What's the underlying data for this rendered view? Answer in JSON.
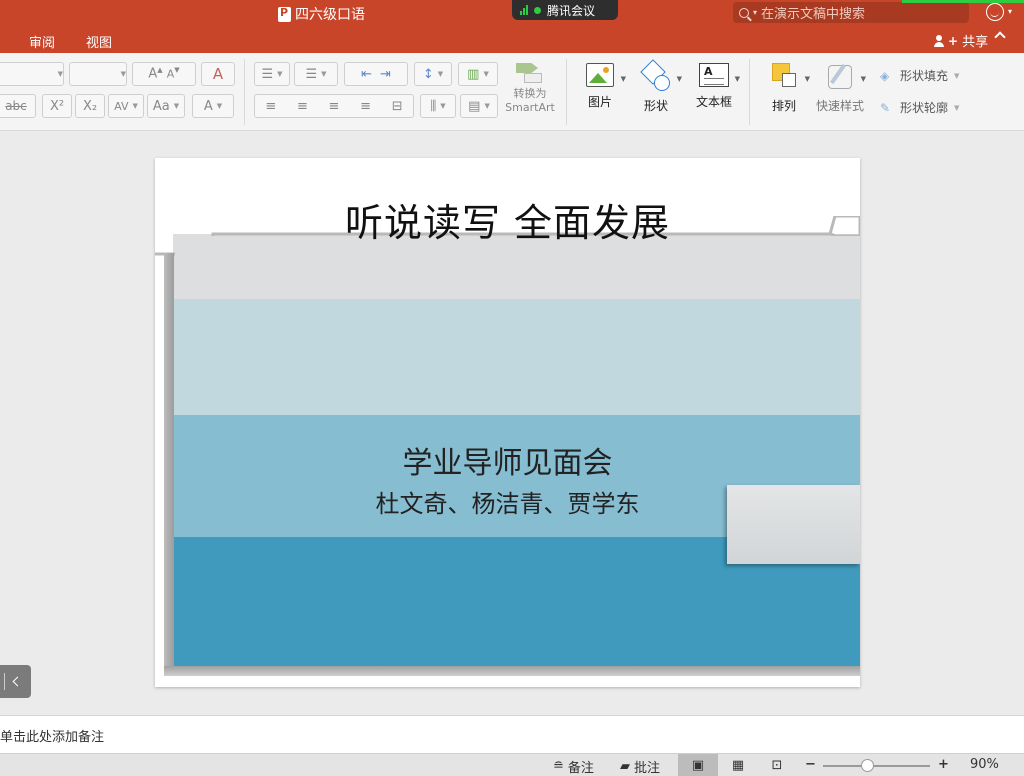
{
  "window": {
    "doc_title": "四六级口语",
    "meeting_label": "腾讯会议",
    "search_placeholder": "在演示文稿中搜索"
  },
  "ribbon": {
    "tabs": [
      {
        "label": "审阅"
      },
      {
        "label": "视图"
      }
    ],
    "share_label": "共享"
  },
  "toolbar": {
    "font_size_glyphs": {
      "grow": "A",
      "shrink": "A"
    },
    "strikethrough": "abc",
    "superscript": "X²",
    "subscript": "X₂",
    "char_spacing": "AV",
    "change_case": "Aa",
    "font_color": "A",
    "convert_smartart_line1": "转换为",
    "convert_smartart_line2": "SmartArt",
    "picture_label": "图片",
    "shape_label": "形状",
    "textbox_label": "文本框",
    "arrange_label": "排列",
    "quick_styles_label": "快速样式",
    "shape_fill_label": "形状填充",
    "shape_outline_label": "形状轮廓"
  },
  "slide": {
    "title": "听说读写 全面发展",
    "subtitle": "学业导师见面会",
    "authors": "杜文奇、杨洁青、贾学东"
  },
  "notes": {
    "placeholder": "单击此处添加备注"
  },
  "statusbar": {
    "notes_label": "备注",
    "comments_label": "批注",
    "zoom_percent": "90%",
    "zoom_level": 0.42
  },
  "colors": {
    "ribbon_accent": "#c8452a",
    "slide_band_1": "#dcdedf",
    "slide_band_2": "#c0d8de",
    "slide_band_3": "#86bdd0",
    "slide_band_4": "#3f9abd"
  }
}
